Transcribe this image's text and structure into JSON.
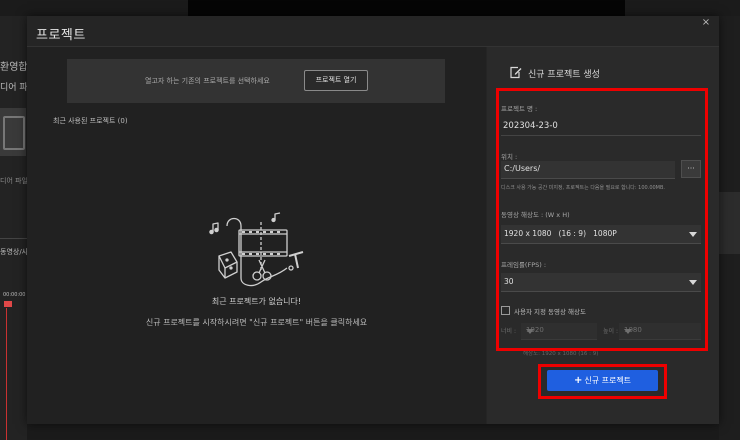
{
  "background": {
    "left_texts": [
      "환영합",
      "디어 파일",
      "디어 파일",
      "동영상/사진",
      "00:00:00"
    ]
  },
  "dialog": {
    "title": "프로젝트",
    "close_label": "×"
  },
  "left_panel": {
    "open_prompt": "열고자 하는 기존의 프로젝트를 선택하세요",
    "open_button": "프로젝트 열기",
    "recent_label": "최근 사용된 프로젝트 (0)",
    "empty_title": "최근 프로젝트가 없습니다!",
    "empty_hint": "신규 프로젝트를 시작하시려면 \"신규 프로젝트\" 버튼을 클릭하세요"
  },
  "right_panel": {
    "title": "신규 프로젝트 생성",
    "project_name_label": "프로젝트 명 :",
    "project_name_value": "202304-23-0",
    "location_label": "위치 :",
    "location_value": "C:/Users/",
    "browse_label": "···",
    "disk_hint": "디스크 사용 가능 공간 미지정, 프로젝트는 다음을 필요로 합니다: 100.00MB.",
    "resolution_label": "동영상 해상도 : (W x H)",
    "resolution_value": "1920 x 1080   (16 : 9)   1080P",
    "fps_label": "프레임률(FPS) :",
    "fps_value": "30",
    "custom_label": "사용자 지정 동영상 해상도",
    "custom_checked": false,
    "width_label": "너비 :",
    "width_value": "1920",
    "height_label": "높이 :",
    "height_value": "1080",
    "custom_note": "해상도: 1920 x 1080  (16 : 9)",
    "new_button_label": "신규 프로젝트",
    "new_button_icon": "plus-icon"
  },
  "colors": {
    "accent": "#1f5fe0",
    "highlight": "#ee0000"
  }
}
